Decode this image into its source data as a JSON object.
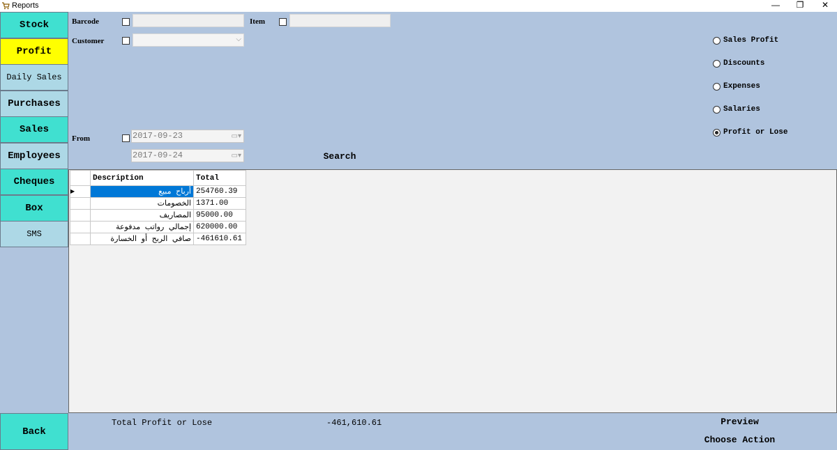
{
  "window": {
    "title": "Reports",
    "controls": {
      "minimize": "—",
      "maximize": "❐",
      "close": "✕"
    }
  },
  "sidebar": {
    "items": [
      {
        "label": "Stock"
      },
      {
        "label": "Profit"
      },
      {
        "label": "Daily Sales"
      },
      {
        "label": "Purchases"
      },
      {
        "label": "Sales"
      },
      {
        "label": "Employees"
      },
      {
        "label": "Cheques"
      },
      {
        "label": "Box"
      },
      {
        "label": "SMS"
      }
    ],
    "back_label": "Back"
  },
  "filters": {
    "barcode_label": "Barcode",
    "item_label": "Item",
    "customer_label": "Customer",
    "from_label": "From",
    "from_date": "2017-09-23",
    "to_date": "2017-09-24",
    "search_label": "Search"
  },
  "report_types": {
    "options": [
      {
        "label": "Sales Profit",
        "selected": false
      },
      {
        "label": "Discounts",
        "selected": false
      },
      {
        "label": "Expenses",
        "selected": false
      },
      {
        "label": "Salaries",
        "selected": false
      },
      {
        "label": "Profit or Lose",
        "selected": true
      }
    ]
  },
  "grid": {
    "columns": [
      "Description",
      "Total"
    ],
    "rows": [
      {
        "description": "أرباح مبيع",
        "total": "254760.39"
      },
      {
        "description": "الخصومات",
        "total": "1371.00"
      },
      {
        "description": "المصاريف",
        "total": "95000.00"
      },
      {
        "description": "إجمالي رواتب مدفوعة",
        "total": "620000.00"
      },
      {
        "description": "صافي الربح أو الخسارة",
        "total": "-461610.61"
      }
    ],
    "current_row_marker": "▶"
  },
  "footer": {
    "total_label": "Total Profit or Lose",
    "total_value": "-461,610.61",
    "preview_label": "Preview",
    "choose_action_label": "Choose Action"
  },
  "colors": {
    "panel": "#b0c4de",
    "turquoise": "#40e0d0",
    "light_blue": "#add8e6",
    "active_yellow": "#ffff00",
    "selection": "#0078d7"
  }
}
